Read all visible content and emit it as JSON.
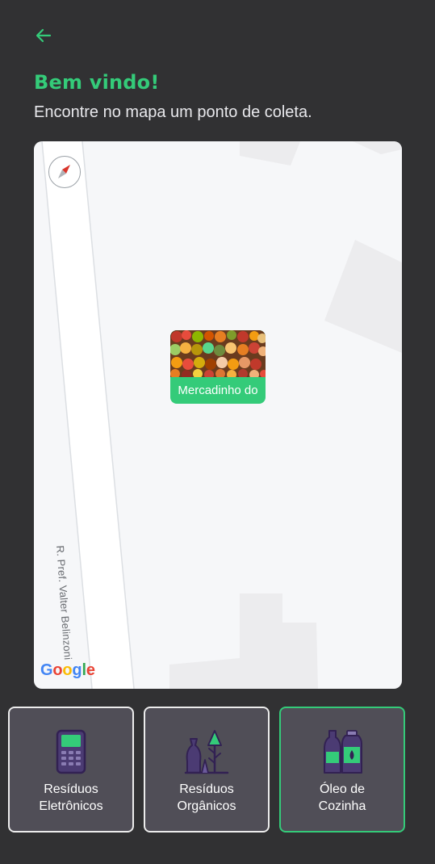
{
  "header": {
    "back_icon": "arrow-left-icon",
    "title": "Bem vindo!",
    "subtitle": "Encontre no mapa um ponto de coleta."
  },
  "map": {
    "street_name": "R. Pref. Valter Belinzoni",
    "compass_icon": "compass-icon",
    "attribution": [
      "G",
      "o",
      "o",
      "g",
      "l",
      "e"
    ],
    "marker": {
      "label": "Mercadinho do",
      "image_icon": "fruit-stand-photo"
    }
  },
  "categories": [
    {
      "label": "Resíduos\nEletrônicos",
      "icon": "electronic-device-icon",
      "selected": false
    },
    {
      "label": "Resíduos\nOrgânicos",
      "icon": "organic-waste-icon",
      "selected": false
    },
    {
      "label": "Óleo de\nCozinha",
      "icon": "cooking-oil-bottles-icon",
      "selected": true
    }
  ],
  "colors": {
    "background": "#313133",
    "accent": "#34cb79",
    "card": "#504e57",
    "card_border": "#ececec",
    "map_bg": "#f6f7f9",
    "icon_outline": "#322153"
  }
}
